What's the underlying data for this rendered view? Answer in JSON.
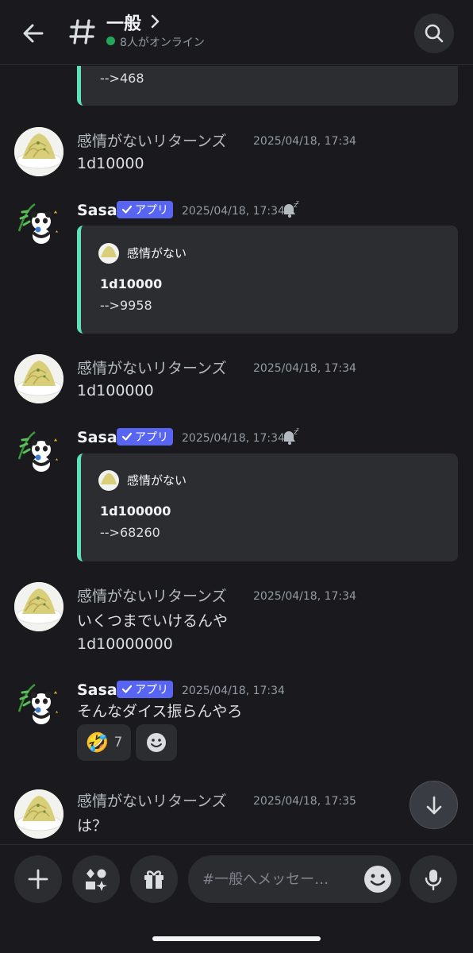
{
  "header": {
    "channel_name": "一般",
    "online_status": "8人がオンライン"
  },
  "icons": {
    "back": "arrow-left-icon",
    "hash": "hash-icon",
    "search": "search-icon",
    "plus": "plus-icon",
    "apps": "apps-icon",
    "gift": "gift-icon",
    "emoji": "emoji-icon",
    "mic": "microphone-icon",
    "scroll_down": "arrow-down-icon"
  },
  "colors": {
    "accent": "#5865f2",
    "online": "#23a55a",
    "embed_bar": "#5ee1b8"
  },
  "messages": [
    {
      "embed_body_partial": "-->468"
    },
    {
      "author": "感情がないリターンズ",
      "timestamp": "2025/04/18, 17:34",
      "text": "1d10000"
    },
    {
      "author": "Sasa",
      "badge": "アプリ",
      "timestamp": "2025/04/18, 17:34",
      "embed": {
        "author": "感情がない",
        "title": "1d10000",
        "body": "-->9958"
      }
    },
    {
      "author": "感情がないリターンズ",
      "timestamp": "2025/04/18, 17:34",
      "text": "1d100000"
    },
    {
      "author": "Sasa",
      "badge": "アプリ",
      "timestamp": "2025/04/18, 17:34",
      "embed": {
        "author": "感情がない",
        "title": "1d100000",
        "body": "-->68260"
      }
    },
    {
      "author": "感情がないリターンズ",
      "timestamp": "2025/04/18, 17:34",
      "text": "いくつまでいけるんや",
      "text2": "1d10000000"
    },
    {
      "author": "Sasa",
      "badge": "アプリ",
      "timestamp": "2025/04/18, 17:34",
      "text": "そんなダイス振らんやろ",
      "reaction": {
        "emoji": "🤣",
        "count": "7"
      }
    },
    {
      "author": "感情がないリターンズ",
      "timestamp": "2025/04/18, 17:35",
      "text": "は？"
    }
  ],
  "composer": {
    "placeholder": "#一般へメッセー…"
  }
}
